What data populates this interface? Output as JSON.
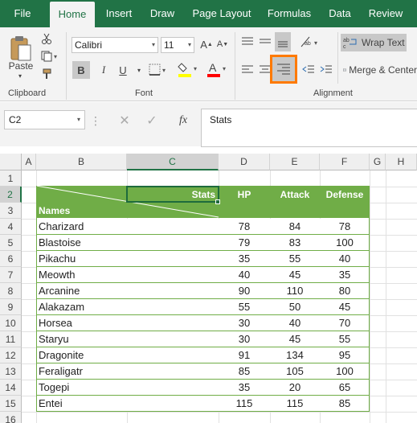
{
  "ribbon_tabs": [
    "File",
    "Home",
    "Insert",
    "Draw",
    "Page Layout",
    "Formulas",
    "Data",
    "Review"
  ],
  "active_tab": "Home",
  "clipboard": {
    "paste_label": "Paste",
    "group_label": "Clipboard"
  },
  "font": {
    "family": "Calibri",
    "size": "11",
    "bold_label": "B",
    "group_label": "Font",
    "highlight_color": "#ffff00",
    "font_color": "#ff0000"
  },
  "alignment": {
    "wrap_text_label": "Wrap Text",
    "merge_label": "Merge & Center",
    "group_label": "Alignment",
    "highlight_box_color": "#ff7a00"
  },
  "formula_bar": {
    "name_box": "C2",
    "fx_label": "fx",
    "formula": "Stats"
  },
  "columns": [
    "A",
    "B",
    "C",
    "D",
    "E",
    "F",
    "G",
    "H"
  ],
  "selected_column": "C",
  "selected_row": "2",
  "rows": [
    "1",
    "2",
    "3",
    "4",
    "5",
    "6",
    "7",
    "8",
    "9",
    "10",
    "11",
    "12",
    "13",
    "14",
    "15",
    "16"
  ],
  "table": {
    "header_stats": "Stats",
    "header_names": "Names",
    "headers": [
      "HP",
      "Attack",
      "Defense"
    ],
    "accent": "#70ad47",
    "records": [
      {
        "name": "Charizard",
        "hp": "78",
        "attack": "84",
        "defense": "78"
      },
      {
        "name": "Blastoise",
        "hp": "79",
        "attack": "83",
        "defense": "100"
      },
      {
        "name": "Pikachu",
        "hp": "35",
        "attack": "55",
        "defense": "40"
      },
      {
        "name": "Meowth",
        "hp": "40",
        "attack": "45",
        "defense": "35"
      },
      {
        "name": "Arcanine",
        "hp": "90",
        "attack": "110",
        "defense": "80"
      },
      {
        "name": "Alakazam",
        "hp": "55",
        "attack": "50",
        "defense": "45"
      },
      {
        "name": "Horsea",
        "hp": "30",
        "attack": "40",
        "defense": "70"
      },
      {
        "name": "Staryu",
        "hp": "30",
        "attack": "45",
        "defense": "55"
      },
      {
        "name": "Dragonite",
        "hp": "91",
        "attack": "134",
        "defense": "95"
      },
      {
        "name": "Feraligatr",
        "hp": "85",
        "attack": "105",
        "defense": "100"
      },
      {
        "name": "Togepi",
        "hp": "35",
        "attack": "20",
        "defense": "65"
      },
      {
        "name": "Entei",
        "hp": "115",
        "attack": "115",
        "defense": "85"
      }
    ]
  }
}
